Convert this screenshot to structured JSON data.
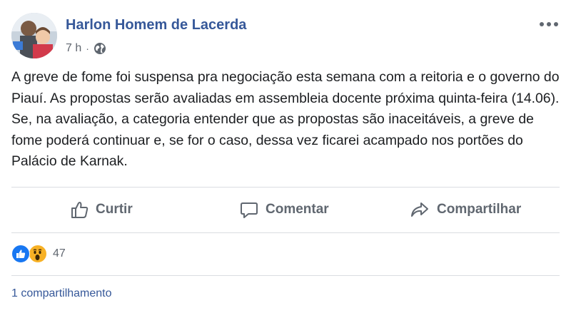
{
  "post": {
    "author": "Harlon Homem de Lacerda",
    "time": "7 h",
    "separator": "·",
    "body": "A greve de fome foi suspensa pra negociação esta semana com a reitoria e o governo do Piauí. As propostas serão avaliadas em assembleia docente próxima quinta-feira (14.06). Se, na avaliação, a categoria entender que as propostas são inaceitáveis, a greve de fome poderá continuar e, se for o caso, dessa vez ficarei acampado nos portões do Palácio de Karnak."
  },
  "actions": {
    "like": "Curtir",
    "comment": "Comentar",
    "share": "Compartilhar"
  },
  "reactions": {
    "count": "47",
    "icons": [
      "like-icon",
      "wow-icon"
    ]
  },
  "shares": {
    "label": "1 compartilhamento"
  },
  "colors": {
    "author": "#365899",
    "text": "#1c1e21",
    "muted": "#606770",
    "like_blue": "#1877f2",
    "wow_yellow": "#f7b125",
    "divider": "#dadde1"
  },
  "icons": {
    "privacy": "globe-icon",
    "menu": "more-options-icon"
  }
}
